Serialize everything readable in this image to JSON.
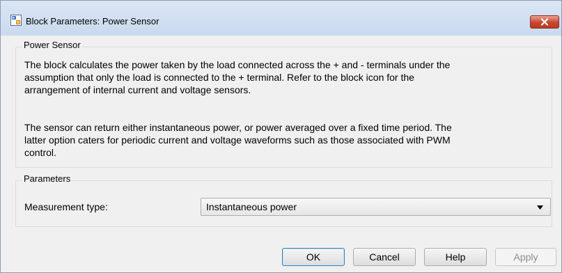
{
  "window": {
    "title": "Block Parameters: Power Sensor"
  },
  "description_panel": {
    "legend": "Power Sensor",
    "lines": [
      "The block calculates the power taken by the load connected across the + and - terminals under the",
      "assumption that only the load is connected to the + terminal. Refer to the block icon for the",
      "arrangement of internal current and voltage sensors.",
      "The sensor can return either instantaneous power, or power averaged over a fixed time period. The",
      "latter option caters for periodic current and voltage waveforms such as those associated with PWM",
      "control."
    ]
  },
  "parameters_panel": {
    "legend": "Parameters",
    "measurement_type": {
      "label": "Measurement type:",
      "selected": "Instantaneous power"
    }
  },
  "buttons": {
    "ok": "OK",
    "cancel": "Cancel",
    "help": "Help",
    "apply": "Apply"
  },
  "colors": {
    "titlebar": "#c9d9ee",
    "dialog_bg": "#f0f0f0",
    "close_button": "#c7462f",
    "default_button_border": "#3c7fb1"
  },
  "icons": {
    "app_icon": "block-parameters-icon",
    "close": "close-icon",
    "dropdown": "chevron-down-icon"
  }
}
